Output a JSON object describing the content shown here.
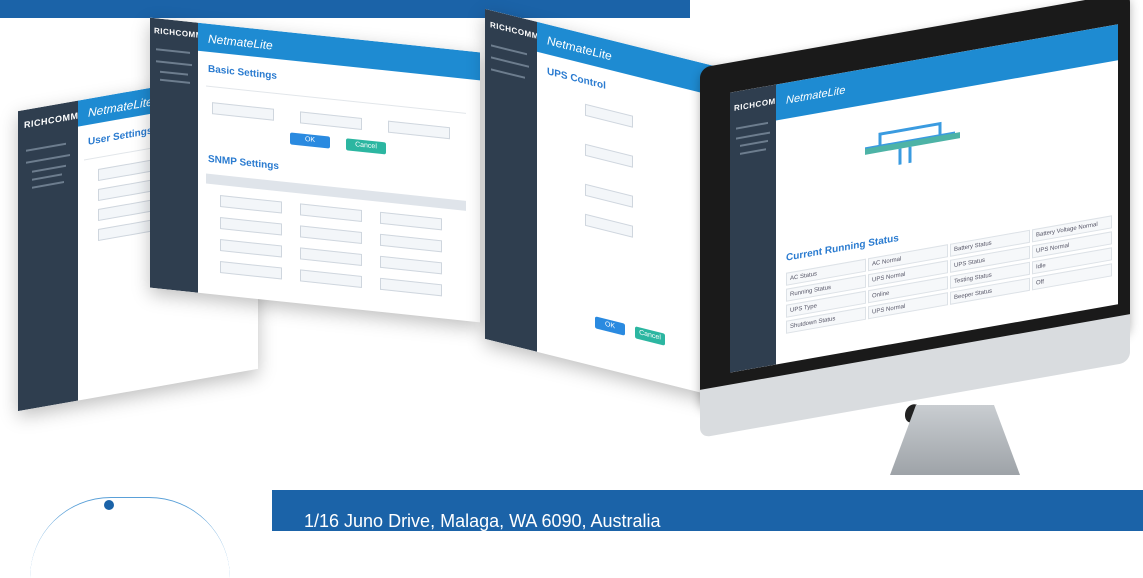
{
  "footer": {
    "address": "1/16 Juno Drive, Malaga, WA 6090, Australia"
  },
  "brand": {
    "logo": "RICHCOMM"
  },
  "app": {
    "title": "NetmateLite"
  },
  "panels": {
    "user": {
      "section": "User Settings"
    },
    "basic": {
      "section": "Basic Settings",
      "snmp_section": "SNMP Settings",
      "ok": "OK",
      "cancel": "Cancel"
    },
    "ups": {
      "section": "UPS Control",
      "ok": "OK",
      "cancel": "Cancel"
    }
  },
  "monitor": {
    "section": "Current Running Status",
    "status_rows": [
      {
        "label": "AC Status",
        "value": "AC Normal"
      },
      {
        "label": "Running Status",
        "value": "UPS Normal"
      },
      {
        "label": "UPS Type",
        "value": "Online"
      },
      {
        "label": "Shutdown Status",
        "value": "UPS Normal"
      }
    ],
    "status_rows_right": [
      {
        "label": "Battery Status",
        "value": "Battery Voltage Normal"
      },
      {
        "label": "UPS Status",
        "value": "UPS Normal"
      },
      {
        "label": "Testing Status",
        "value": "Idle"
      },
      {
        "label": "Beeper Status",
        "value": "Off"
      }
    ]
  },
  "colors": {
    "brand_blue": "#1b63a8",
    "header_blue": "#1e8bd2",
    "sidebar": "#2f3e4f"
  }
}
